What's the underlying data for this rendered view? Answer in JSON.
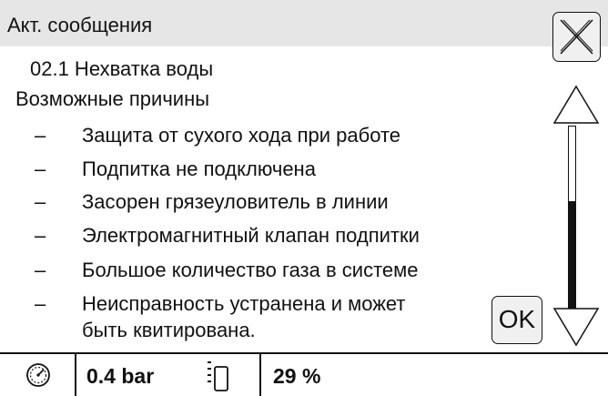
{
  "window": {
    "title": "Акт. сообщения"
  },
  "message": {
    "code_title": "02.1 Нехватка воды",
    "causes_heading": "Возможные причины",
    "causes": [
      "Защита от сухого хода при работе",
      "Подпитка не подключена",
      "Засорен грязеуловитель в линии",
      "Электромагнитный клапан подпитки",
      "Большое количество газа в системе",
      "Неисправность устранена и может",
      "быть квитирована."
    ],
    "dash": "–"
  },
  "buttons": {
    "ok_label": "OK"
  },
  "icons": {
    "close": "close-x-icon",
    "scroll_up": "triangle-up-icon",
    "scroll_down": "triangle-down-icon",
    "pressure": "pressure-gauge-icon",
    "level": "tank-level-icon"
  },
  "scroll": {
    "position_fraction": 0.6
  },
  "status": {
    "pressure": "0.4 bar",
    "level": "29 %"
  }
}
